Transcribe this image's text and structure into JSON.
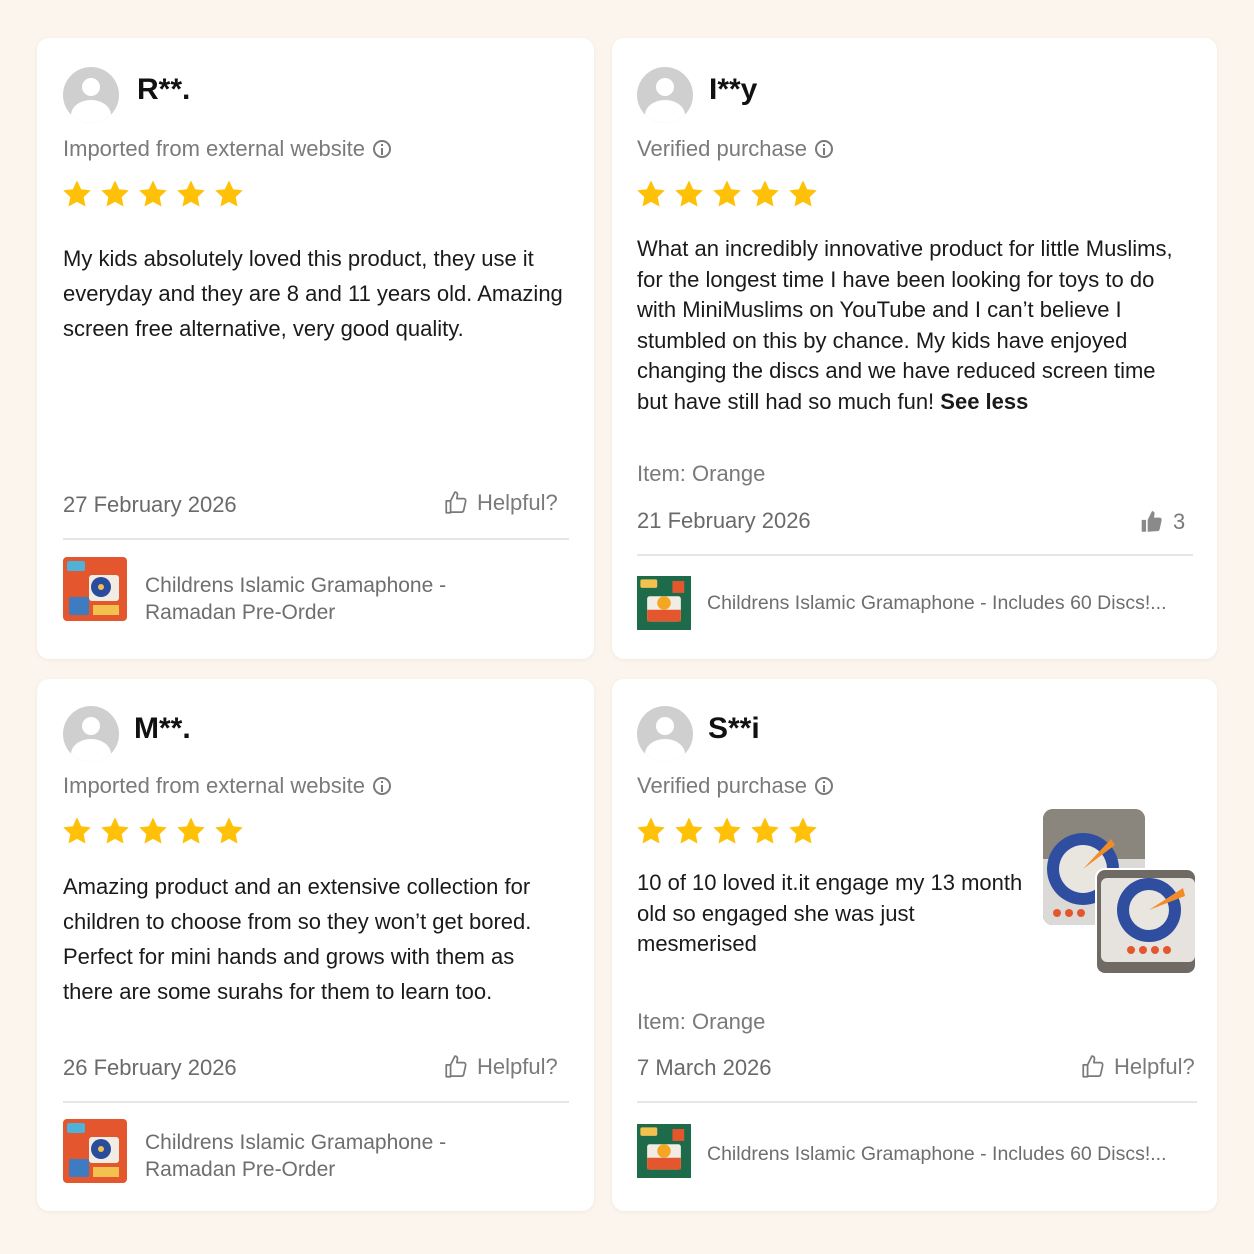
{
  "colors": {
    "background": "#fcf5ee",
    "star": "#ffc107",
    "muted_text": "#7a7a7a"
  },
  "reviews": [
    {
      "reviewer": "R**.",
      "source": "Imported from external website",
      "source_icon": "info-icon",
      "rating": 5,
      "text": "My kids absolutely loved this product,  they use it everyday and they are 8 and 11 years old. Amazing screen free alternative, very good quality.",
      "date": "27 February 2026",
      "helpful_label": "Helpful?",
      "product_name": "Childrens Islamic Gramaphone - Ramadan Pre-Order"
    },
    {
      "reviewer": "I**y",
      "source": "Verified purchase",
      "source_icon": "info-icon",
      "rating": 5,
      "text": "What an incredibly innovative product for little Muslims, for the longest time I have been looking for toys to do with MiniMuslims on YouTube and I can’t believe I stumbled on this by chance. My kids have enjoyed changing the discs and we have reduced screen time but have still had so much fun!",
      "see_less": "See less",
      "item": "Item: Orange",
      "date": "21 February 2026",
      "helpful_count": "3",
      "product_name": "Childrens Islamic Gramaphone - Includes 60 Discs!..."
    },
    {
      "reviewer": "M**.",
      "source": "Imported from external website",
      "source_icon": "info-icon",
      "rating": 5,
      "text": "Amazing product and an extensive collection for children to choose from so they won’t get bored. Perfect for mini hands and grows with them as there are some surahs for them to learn too.",
      "date": "26 February 2026",
      "helpful_label": "Helpful?",
      "product_name": "Childrens Islamic Gramaphone - Ramadan Pre-Order"
    },
    {
      "reviewer": "S**i",
      "source": "Verified purchase",
      "source_icon": "info-icon",
      "rating": 5,
      "text": "10 of 10 loved it.it engage my 13 month old so engaged she was just mesmerised",
      "item": "Item: Orange",
      "date": "7 March 2026",
      "helpful_label": "Helpful?",
      "product_name": "Childrens Islamic Gramaphone - Includes 60 Discs!..."
    }
  ]
}
